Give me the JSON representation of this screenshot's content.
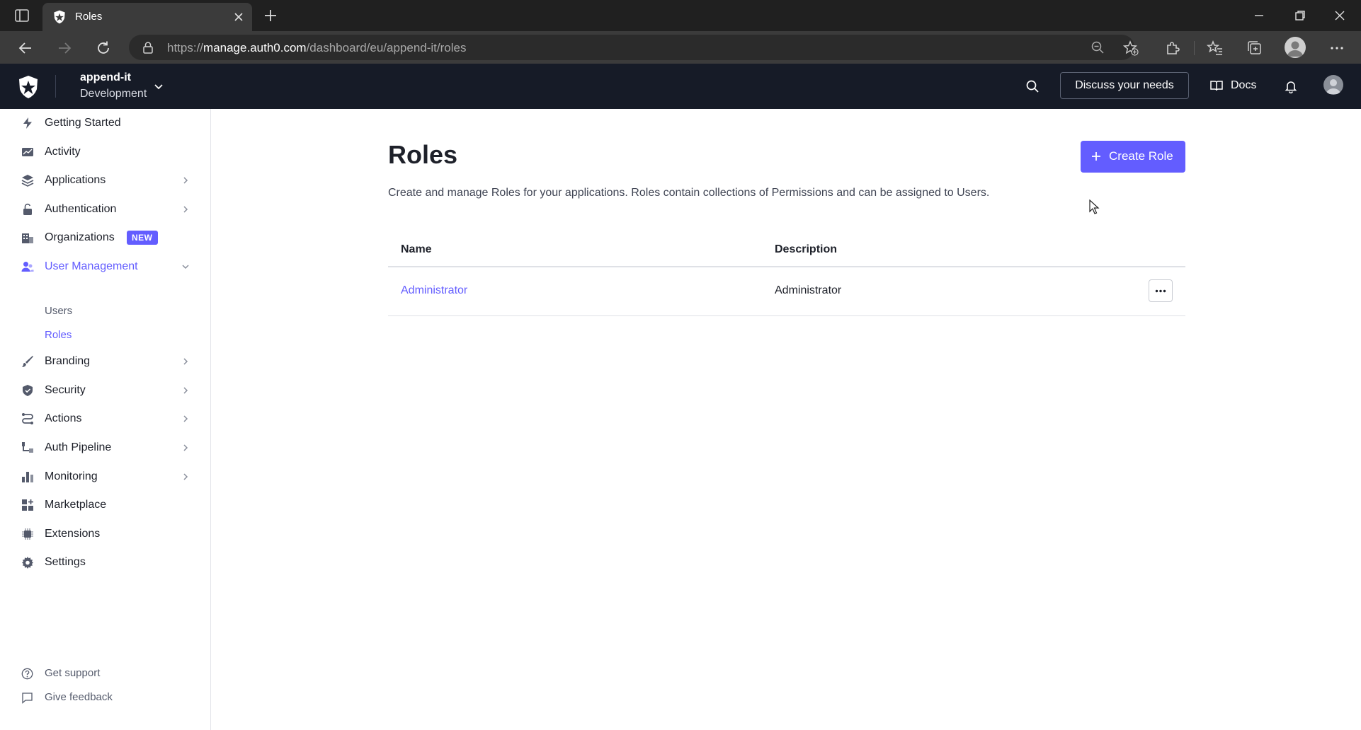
{
  "browser": {
    "tab_title": "Roles",
    "url_prefix": "https://",
    "url_host": "manage.auth0.com",
    "url_path": "/dashboard/eu/append-it/roles",
    "icons": [
      "sidebar-toggle-icon",
      "close-icon",
      "plus-icon",
      "back-icon",
      "forward-icon",
      "refresh-icon",
      "lock-icon",
      "zoom-icon",
      "add-favorite-icon",
      "extensions-icon",
      "favorites-icon",
      "collections-icon",
      "profile-icon",
      "more-icon"
    ]
  },
  "header": {
    "tenant_name": "append-it",
    "tenant_env": "Development",
    "discuss_label": "Discuss your needs",
    "docs_label": "Docs",
    "colors": {
      "background": "#161b27",
      "accent": "#635dff"
    }
  },
  "sidebar": {
    "items": [
      {
        "label": "Getting Started",
        "icon": "lightning-icon"
      },
      {
        "label": "Activity",
        "icon": "activity-chart-icon"
      },
      {
        "label": "Applications",
        "icon": "layers-icon",
        "expandable": true
      },
      {
        "label": "Authentication",
        "icon": "lock-open-icon",
        "expandable": true
      },
      {
        "label": "Organizations",
        "icon": "building-icon",
        "badge": "NEW"
      },
      {
        "label": "User Management",
        "icon": "users-icon",
        "expandable": true,
        "expanded": true,
        "active": true
      },
      {
        "label": "Branding",
        "icon": "brush-icon",
        "expandable": true
      },
      {
        "label": "Security",
        "icon": "shield-icon",
        "expandable": true
      },
      {
        "label": "Actions",
        "icon": "flow-icon",
        "expandable": true
      },
      {
        "label": "Auth Pipeline",
        "icon": "pipeline-icon",
        "expandable": true
      },
      {
        "label": "Monitoring",
        "icon": "bar-chart-icon",
        "expandable": true
      },
      {
        "label": "Marketplace",
        "icon": "grid-plus-icon"
      },
      {
        "label": "Extensions",
        "icon": "chip-icon"
      },
      {
        "label": "Settings",
        "icon": "gear-icon"
      }
    ],
    "sub_items": [
      {
        "label": "Users",
        "active": false
      },
      {
        "label": "Roles",
        "active": true
      }
    ],
    "footer": [
      {
        "label": "Get support",
        "icon": "help-circle-icon"
      },
      {
        "label": "Give feedback",
        "icon": "chat-bubble-icon"
      }
    ]
  },
  "main": {
    "title": "Roles",
    "create_label": "Create Role",
    "description": "Create and manage Roles for your applications. Roles contain collections of Permissions and can be assigned to Users.",
    "table": {
      "columns": [
        "Name",
        "Description"
      ],
      "rows": [
        {
          "name": "Administrator",
          "description": "Administrator"
        }
      ]
    }
  }
}
